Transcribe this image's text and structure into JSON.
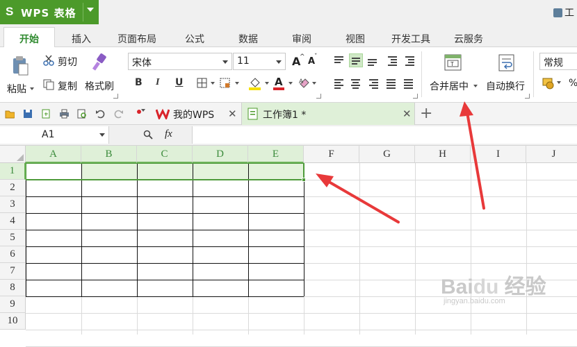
{
  "app": {
    "logo_glyph": "S",
    "title": "WPS 表格",
    "right_tool_label": "工"
  },
  "menu_tabs": [
    {
      "label": "开始",
      "active": true
    },
    {
      "label": "插入"
    },
    {
      "label": "页面布局"
    },
    {
      "label": "公式"
    },
    {
      "label": "数据"
    },
    {
      "label": "审阅"
    },
    {
      "label": "视图"
    },
    {
      "label": "开发工具"
    },
    {
      "label": "云服务"
    }
  ],
  "ribbon": {
    "paste_label": "粘贴",
    "cut_label": "剪切",
    "copy_label": "复制",
    "format_painter_label": "格式刷",
    "font_name": "宋体",
    "font_size": "11",
    "grow_font": "A",
    "shrink_font": "A",
    "bold": "B",
    "italic": "I",
    "underline": "U",
    "font_color_glyph": "A",
    "merge_center_label": "合并居中",
    "wrap_text_label": "自动换行",
    "number_format": "常规",
    "percent_glyph": "%"
  },
  "doc_tabs": [
    {
      "label": "我的WPS"
    },
    {
      "label": "工作簿1 *",
      "active": true
    }
  ],
  "formula_bar": {
    "name_box": "A1",
    "fx_label": "fx",
    "formula": ""
  },
  "grid": {
    "columns": [
      "A",
      "B",
      "C",
      "D",
      "E",
      "F",
      "G",
      "H",
      "I",
      "J"
    ],
    "rows": [
      "1",
      "2",
      "3",
      "4",
      "5",
      "6",
      "7",
      "8",
      "9",
      "10"
    ],
    "selected_range": "A1:E1",
    "bordered_range": "A1:E8"
  },
  "colors": {
    "accent": "#4c9a2a",
    "selection": "#4e9a3a",
    "highlight": "#dff0d8",
    "annotation_arrow": "#e8393a"
  },
  "icons": [
    "paste-icon",
    "scissors-icon",
    "copy-icon",
    "brush-icon",
    "merge-cells-icon",
    "wrap-text-icon",
    "open-folder-icon",
    "save-icon",
    "print-icon",
    "undo-icon",
    "redo-icon",
    "zoom-icon"
  ]
}
